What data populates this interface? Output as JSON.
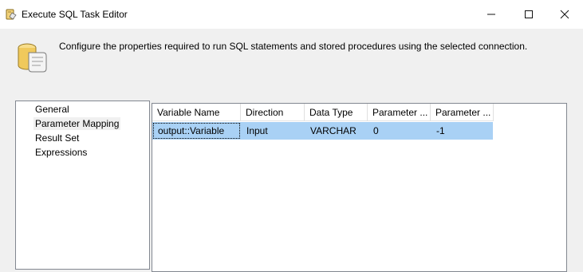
{
  "window": {
    "title": "Execute SQL Task Editor"
  },
  "header": {
    "description": "Configure the properties required to run SQL statements and stored procedures using the selected connection."
  },
  "nav": {
    "items": [
      {
        "label": "General"
      },
      {
        "label": "Parameter Mapping",
        "selected": true
      },
      {
        "label": "Result Set"
      },
      {
        "label": "Expressions"
      }
    ]
  },
  "grid": {
    "columns": [
      "Variable Name",
      "Direction",
      "Data Type",
      "Parameter ...",
      "Parameter ..."
    ],
    "rows": [
      {
        "variable_name": "output::Variable",
        "direction": "Input",
        "data_type": "VARCHAR",
        "parameter_name": "0",
        "parameter_size": "-1"
      }
    ]
  },
  "colors": {
    "selection": "#a9d1f5",
    "border": "#828790",
    "background": "#f0f0f0"
  },
  "icons": {
    "app": "sql-task-icon",
    "header": "database-scroll-icon"
  }
}
